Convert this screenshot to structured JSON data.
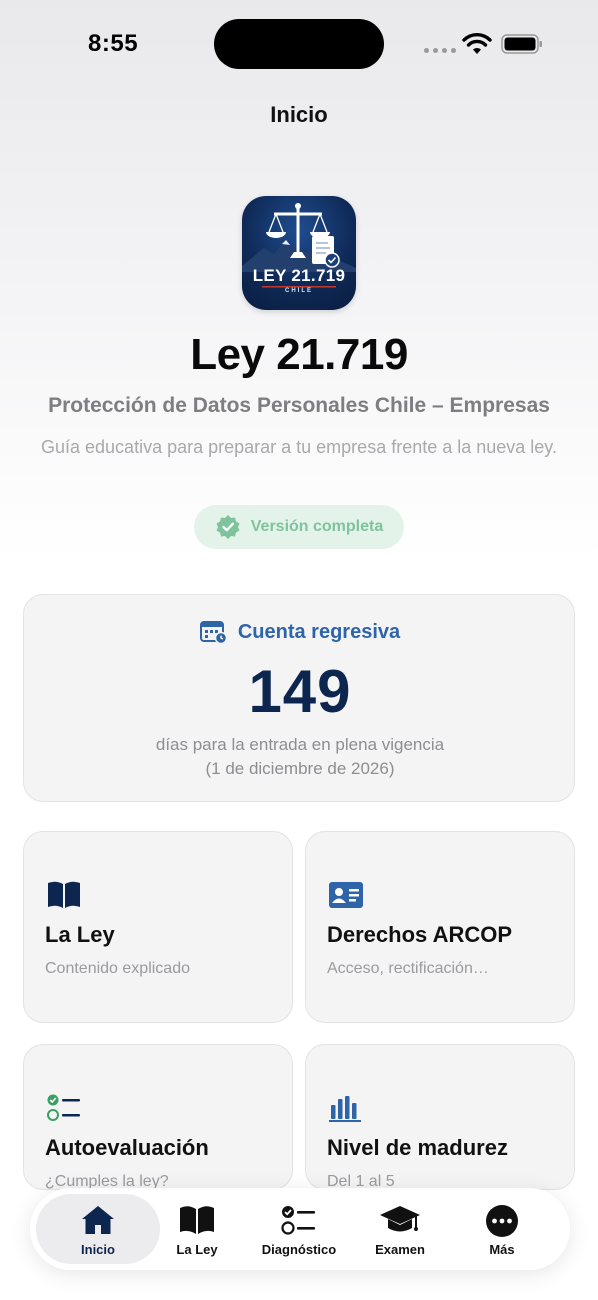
{
  "status_bar": {
    "time": "8:55"
  },
  "nav": {
    "title": "Inicio"
  },
  "app": {
    "icon_text": "LEY 21.719",
    "icon_subtext": "CHILE",
    "name": "Ley 21.719",
    "subtitle": "Protección de Datos Personales Chile – Empresas",
    "description": "Guía educativa para preparar a tu empresa frente a la nueva ley.",
    "badge": "Versión completa",
    "badge_color": "#7fc39c"
  },
  "countdown": {
    "title": "Cuenta regresiva",
    "days": "149",
    "line1": "días para la entrada en plena vigencia",
    "line2": "(1 de diciembre de 2026)",
    "accent_color": "#2e64a8",
    "number_color": "#0d2650"
  },
  "cards": [
    {
      "title": "La Ley",
      "subtitle": "Contenido explicado",
      "icon": "book-icon"
    },
    {
      "title": "Derechos ARCOP",
      "subtitle": "Acceso, rectificación…",
      "icon": "id-card-icon"
    },
    {
      "title": "Autoevaluación",
      "subtitle": "¿Cumples la ley?",
      "icon": "checklist-icon"
    },
    {
      "title": "Nivel de madurez",
      "subtitle": "Del 1 al 5",
      "icon": "bar-chart-icon"
    }
  ],
  "tabs": [
    {
      "label": "Inicio",
      "icon": "house-icon",
      "active": true
    },
    {
      "label": "La Ley",
      "icon": "book-icon"
    },
    {
      "label": "Diagnóstico",
      "icon": "checklist-icon"
    },
    {
      "label": "Examen",
      "icon": "graduation-cap-icon"
    },
    {
      "label": "Más",
      "icon": "more-icon"
    }
  ]
}
